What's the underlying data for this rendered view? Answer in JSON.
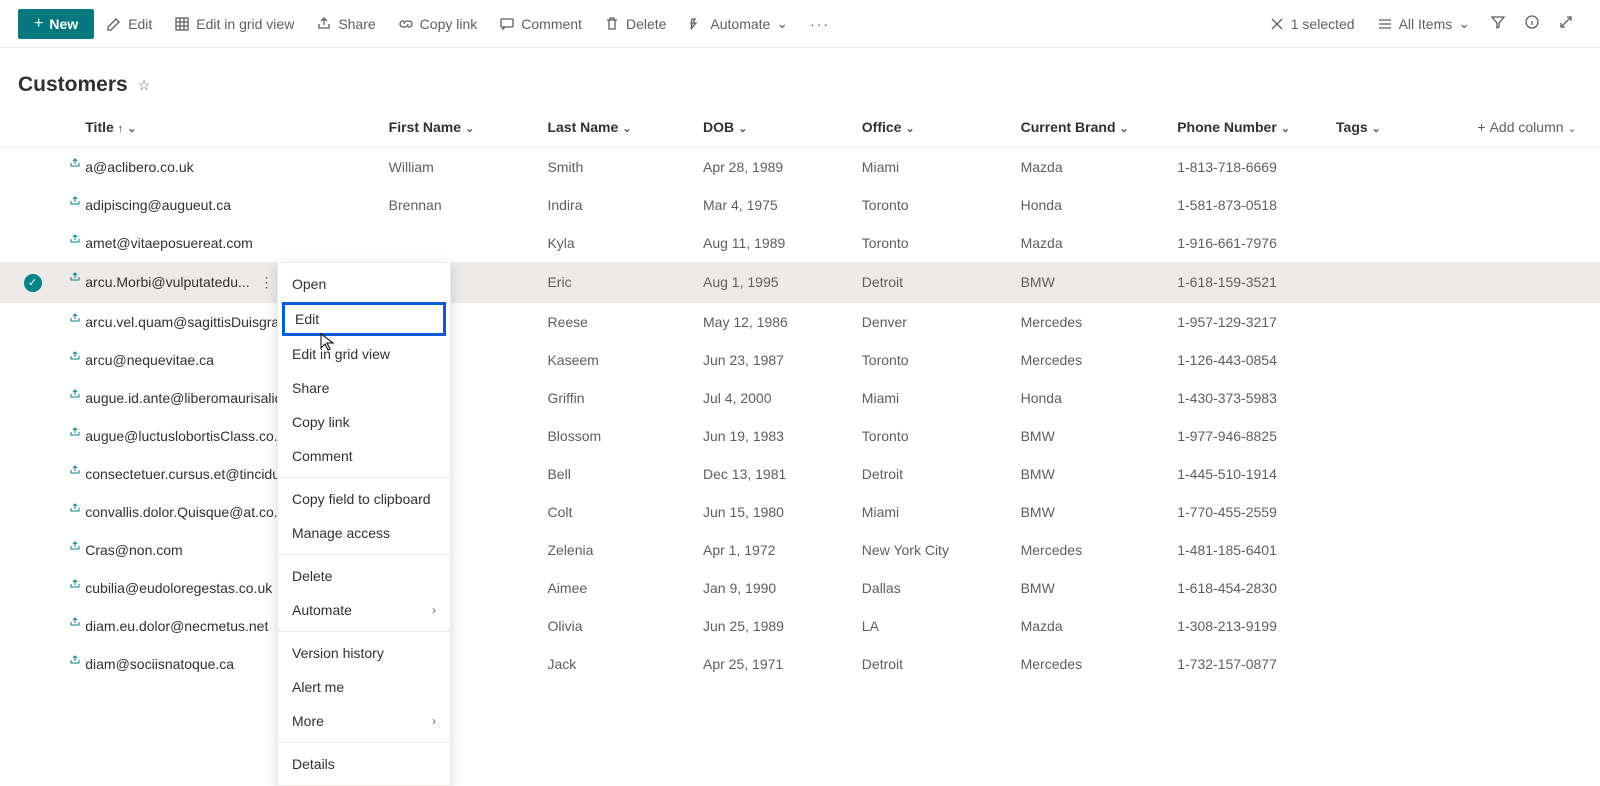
{
  "toolbar": {
    "new": "New",
    "edit": "Edit",
    "edit_grid": "Edit in grid view",
    "share": "Share",
    "copy_link": "Copy link",
    "comment": "Comment",
    "delete": "Delete",
    "automate": "Automate",
    "selected": "1 selected",
    "view": "All Items"
  },
  "page": {
    "title": "Customers"
  },
  "columns": {
    "title": "Title",
    "first": "First Name",
    "last": "Last Name",
    "dob": "DOB",
    "office": "Office",
    "brand": "Current Brand",
    "phone": "Phone Number",
    "tags": "Tags",
    "add": "Add column"
  },
  "rows": [
    {
      "title": "a@aclibero.co.uk",
      "first": "William",
      "last": "Smith",
      "dob": "Apr 28, 1989",
      "office": "Miami",
      "brand": "Mazda",
      "phone": "1-813-718-6669",
      "selected": false
    },
    {
      "title": "adipiscing@augueut.ca",
      "first": "Brennan",
      "last": "Indira",
      "dob": "Mar 4, 1975",
      "office": "Toronto",
      "brand": "Honda",
      "phone": "1-581-873-0518",
      "selected": false
    },
    {
      "title": "amet@vitaeposuereat.com",
      "first": "",
      "last": "Kyla",
      "dob": "Aug 11, 1989",
      "office": "Toronto",
      "brand": "Mazda",
      "phone": "1-916-661-7976",
      "selected": false
    },
    {
      "title": "arcu.Morbi@vulputatedu...",
      "first": "",
      "last": "Eric",
      "dob": "Aug 1, 1995",
      "office": "Detroit",
      "brand": "BMW",
      "phone": "1-618-159-3521",
      "selected": true
    },
    {
      "title": "arcu.vel.quam@sagittisDuisgravid",
      "first": "",
      "last": "Reese",
      "dob": "May 12, 1986",
      "office": "Denver",
      "brand": "Mercedes",
      "phone": "1-957-129-3217",
      "selected": false
    },
    {
      "title": "arcu@nequevitae.ca",
      "first": "",
      "last": "Kaseem",
      "dob": "Jun 23, 1987",
      "office": "Toronto",
      "brand": "Mercedes",
      "phone": "1-126-443-0854",
      "selected": false
    },
    {
      "title": "augue.id.ante@liberomaurisaliqua",
      "first": "",
      "last": "Griffin",
      "dob": "Jul 4, 2000",
      "office": "Miami",
      "brand": "Honda",
      "phone": "1-430-373-5983",
      "selected": false
    },
    {
      "title": "augue@luctuslobortisClass.co.uk",
      "first": "",
      "last": "Blossom",
      "dob": "Jun 19, 1983",
      "office": "Toronto",
      "brand": "BMW",
      "phone": "1-977-946-8825",
      "selected": false
    },
    {
      "title": "consectetuer.cursus.et@tinciduntl",
      "first": "",
      "last": "Bell",
      "dob": "Dec 13, 1981",
      "office": "Detroit",
      "brand": "BMW",
      "phone": "1-445-510-1914",
      "selected": false
    },
    {
      "title": "convallis.dolor.Quisque@at.co.uk",
      "first": "",
      "last": "Colt",
      "dob": "Jun 15, 1980",
      "office": "Miami",
      "brand": "BMW",
      "phone": "1-770-455-2559",
      "selected": false
    },
    {
      "title": "Cras@non.com",
      "first": "",
      "last": "Zelenia",
      "dob": "Apr 1, 1972",
      "office": "New York City",
      "brand": "Mercedes",
      "phone": "1-481-185-6401",
      "selected": false
    },
    {
      "title": "cubilia@eudoloregestas.co.uk",
      "first": "",
      "last": "Aimee",
      "dob": "Jan 9, 1990",
      "office": "Dallas",
      "brand": "BMW",
      "phone": "1-618-454-2830",
      "selected": false
    },
    {
      "title": "diam.eu.dolor@necmetus.net",
      "first": "",
      "last": "Olivia",
      "dob": "Jun 25, 1989",
      "office": "LA",
      "brand": "Mazda",
      "phone": "1-308-213-9199",
      "selected": false
    },
    {
      "title": "diam@sociisnatoque.ca",
      "first": "",
      "last": "Jack",
      "dob": "Apr 25, 1971",
      "office": "Detroit",
      "brand": "Mercedes",
      "phone": "1-732-157-0877",
      "selected": false
    }
  ],
  "context_menu": {
    "open": "Open",
    "edit": "Edit",
    "edit_grid": "Edit in grid view",
    "share": "Share",
    "copy_link": "Copy link",
    "comment": "Comment",
    "copy_field": "Copy field to clipboard",
    "manage_access": "Manage access",
    "delete": "Delete",
    "automate": "Automate",
    "version_history": "Version history",
    "alert_me": "Alert me",
    "more": "More",
    "details": "Details"
  }
}
